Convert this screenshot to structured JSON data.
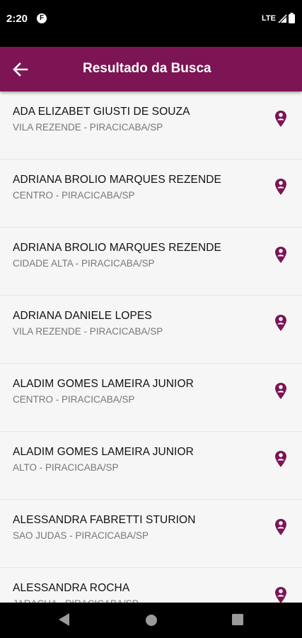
{
  "status_bar": {
    "time": "2:20",
    "notification_icon": "F",
    "network": "LTE"
  },
  "header": {
    "title": "Resultado da Busca",
    "back_icon": "arrow-left-icon"
  },
  "theme": {
    "accent": "#7d1454",
    "background": "#f6f6f6",
    "divider": "#e6e6e6"
  },
  "results": [
    {
      "name": "ADA ELIZABET GIUSTI DE SOUZA",
      "location": "VILA REZENDE - PIRACICABA/SP"
    },
    {
      "name": "ADRIANA BROLIO MARQUES REZENDE",
      "location": "CENTRO - PIRACICABA/SP"
    },
    {
      "name": "ADRIANA BROLIO MARQUES REZENDE",
      "location": "CIDADE ALTA - PIRACICABA/SP"
    },
    {
      "name": "ADRIANA DANIELE LOPES",
      "location": "VILA REZENDE - PIRACICABA/SP"
    },
    {
      "name": "ALADIM GOMES LAMEIRA JUNIOR",
      "location": "CENTRO - PIRACICABA/SP"
    },
    {
      "name": "ALADIM GOMES LAMEIRA JUNIOR",
      "location": "ALTO - PIRACICABA/SP"
    },
    {
      "name": "ALESSANDRA FABRETTI STURION",
      "location": "SAO JUDAS - PIRACICABA/SP"
    },
    {
      "name": "ALESSANDRA ROCHA",
      "location": "JARACUA - PIRACICABA/SP"
    }
  ]
}
